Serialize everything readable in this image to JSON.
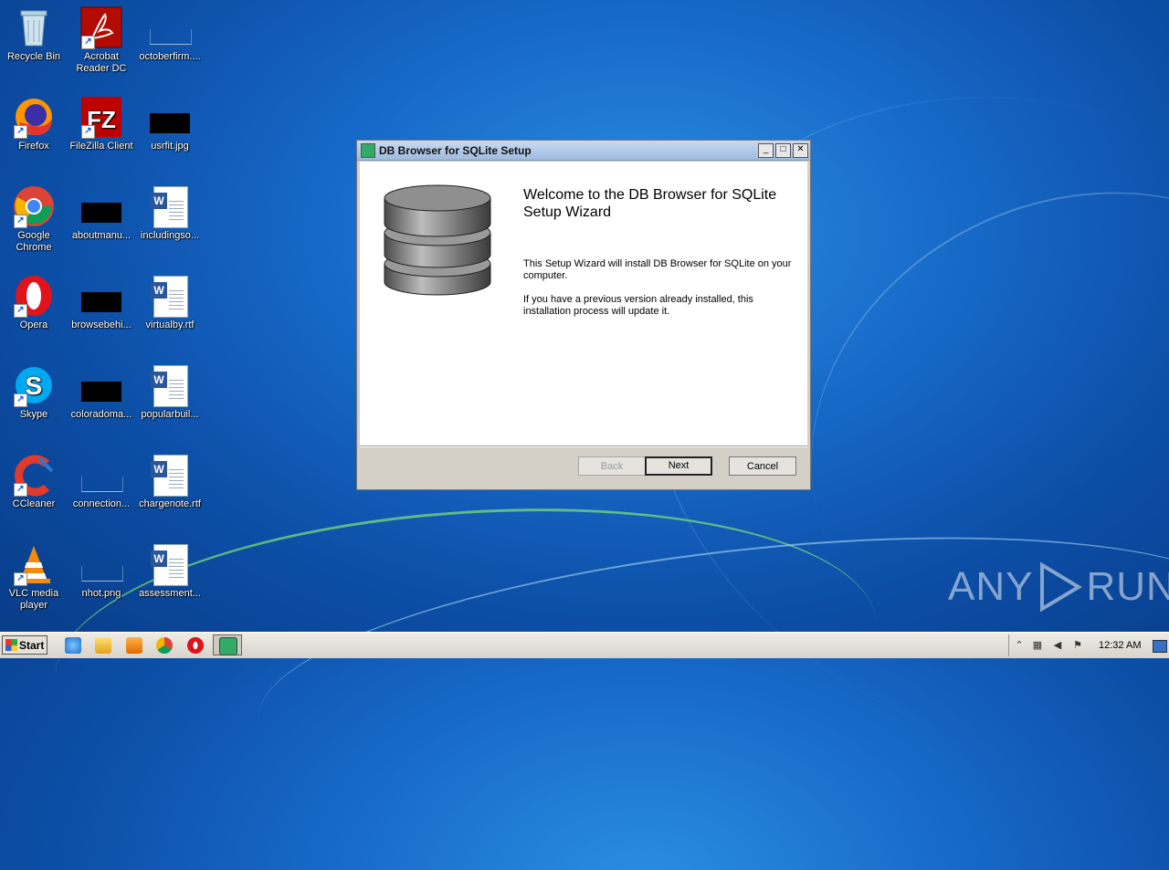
{
  "desktop": {
    "icons": [
      {
        "label": "Recycle Bin"
      },
      {
        "label": "Acrobat Reader DC"
      },
      {
        "label": "octoberfirm...."
      },
      {
        "label": "Firefox"
      },
      {
        "label": "FileZilla Client"
      },
      {
        "label": "usrfit.jpg"
      },
      {
        "label": "Google Chrome"
      },
      {
        "label": "aboutmanu..."
      },
      {
        "label": "includingso..."
      },
      {
        "label": "Opera"
      },
      {
        "label": "browsebehi..."
      },
      {
        "label": "virtualby.rtf"
      },
      {
        "label": "Skype"
      },
      {
        "label": "coloradoma..."
      },
      {
        "label": "popularbuil..."
      },
      {
        "label": "CCleaner"
      },
      {
        "label": "connection..."
      },
      {
        "label": "chargenote.rtf"
      },
      {
        "label": "VLC media player"
      },
      {
        "label": "nhot.png"
      },
      {
        "label": "assessment..."
      }
    ]
  },
  "dialog": {
    "title": "DB Browser for SQLite Setup",
    "heading": "Welcome to the DB Browser for SQLite Setup Wizard",
    "paragraph1": "This Setup Wizard will install DB Browser for SQLite on your computer.",
    "paragraph2": "If you have a previous version already installed, this installation process will update it.",
    "buttons": {
      "back": "Back",
      "next": "Next",
      "cancel": "Cancel"
    },
    "window_controls": {
      "minimize": "_",
      "maximize": "□",
      "close": "✕"
    }
  },
  "taskbar": {
    "start_label": "Start",
    "clock": "12:32 AM"
  },
  "watermark": {
    "left": "ANY",
    "right": "RUN"
  }
}
